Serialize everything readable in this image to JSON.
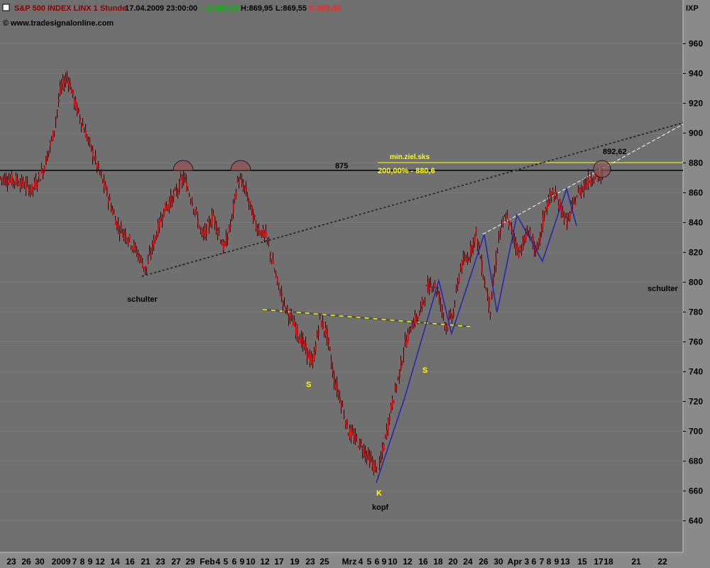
{
  "header": {
    "symbol": "S&P 500 INDEX LINX 1 Stunde",
    "datetime": "17.04.2009 23:00:00",
    "open": "- O:869,95",
    "high": "H:869,95",
    "low": "L:869,55",
    "close": "C:869,80",
    "source": "www.tradesignalonline.com",
    "corner": "IXP"
  },
  "colors": {
    "background": "#6f6f6f",
    "candle": "#b00000",
    "trendline_blue": "#2020a0",
    "target_line": "#ffff00",
    "label_yellow": "#ffff00"
  },
  "chart_data": {
    "type": "line",
    "title": "S&P 500 INDEX LINX 1 Stunde",
    "ylim": [
      625,
      975
    ],
    "y_ticks": [
      640,
      660,
      680,
      700,
      720,
      740,
      760,
      780,
      800,
      820,
      840,
      860,
      880,
      900,
      920,
      940,
      960
    ],
    "x_ticks": [
      "23",
      "26",
      "30",
      "2009",
      "7",
      "8",
      "9",
      "12",
      "14",
      "16",
      "21",
      "23",
      "27",
      "29",
      "Feb",
      "4",
      "5",
      "6",
      "9",
      "10",
      "12",
      "17",
      "19",
      "23",
      "25",
      "Mrz",
      "4",
      "5",
      "6",
      "9",
      "10",
      "12",
      "16",
      "18",
      "20",
      "24",
      "26",
      "30",
      "Apr",
      "3",
      "6",
      "7",
      "8",
      "9",
      "13",
      "15",
      "17",
      "18",
      "21",
      "22"
    ],
    "series": [
      {
        "x": [
          0,
          25,
          45,
          60,
          75,
          85,
          95,
          105,
          120,
          135,
          150,
          165,
          180,
          195,
          205,
          215,
          230,
          245,
          258,
          270,
          285,
          300,
          315,
          325,
          335,
          345,
          360,
          375,
          390,
          400,
          415,
          425,
          440,
          450,
          460,
          470,
          480,
          490,
          500,
          512,
          522,
          532,
          540,
          550,
          560,
          570,
          580,
          590,
          600,
          610,
          618,
          628,
          638,
          648,
          660,
          670,
          680,
          690,
          702,
          712,
          720,
          730,
          745,
          755,
          768,
          778,
          790,
          798,
          812,
          822,
          832,
          840,
          848
        ],
        "values": [
          870,
          868,
          862,
          875,
          900,
          930,
          938,
          920,
          900,
          880,
          860,
          838,
          830,
          818,
          808,
          825,
          848,
          858,
          870,
          855,
          830,
          845,
          822,
          840,
          870,
          862,
          838,
          830,
          800,
          785,
          770,
          760,
          745,
          775,
          765,
          735,
          720,
          700,
          695,
          688,
          680,
          672,
          690,
          715,
          735,
          758,
          772,
          778,
          795,
          800,
          790,
          770,
          780,
          810,
          818,
          833,
          805,
          782,
          830,
          845,
          835,
          820,
          835,
          818,
          850,
          860,
          850,
          840,
          858,
          865,
          870,
          872,
          870
        ]
      }
    ]
  },
  "annotations": {
    "level_875": "875",
    "target_label": "min.ziel.sks",
    "target_value": "200,00% - 880,6",
    "level_892": "892,62",
    "left_shoulder": "schulter",
    "right_shoulder": "schulter",
    "head": "kopf",
    "s_left": "S",
    "s_right": "S",
    "k": "K"
  }
}
